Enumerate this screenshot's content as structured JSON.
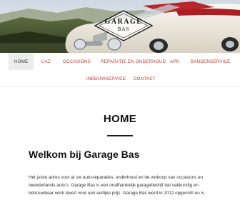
{
  "hero": {
    "logo_name": "GARAGE",
    "logo_sub": "BAS"
  },
  "nav": {
    "items": [
      {
        "label": "HOME"
      },
      {
        "label": "UAZ"
      },
      {
        "label": "OCCASIONS"
      },
      {
        "label": "REPARATIE EN ONDERHOUD"
      },
      {
        "label": "APK"
      },
      {
        "label": "BANDENSERVICE"
      },
      {
        "label": "INBOUWSERVICE"
      },
      {
        "label": "CONTACT"
      }
    ]
  },
  "main": {
    "page_title": "HOME",
    "heading": "Welkom bij Garage Bas",
    "intro_line1": "Het juiste adres voor al uw auto-reparaties, onderhoud en de verkoop van occasions en",
    "intro_line2": "tweedehands auto’s. Garage Bas is een onafhankelijk garagebedrijf dat vakkundig en",
    "intro_line3": "betrouwbaar werk levert voor een eerlijke prijs. Garage Bas werd in 2012 opgericht en is"
  },
  "colors": {
    "accent": "#c0392b",
    "active_nav_bg": "#ececec",
    "car_white": "#f1ede4",
    "interior_red": "#b8262b"
  }
}
